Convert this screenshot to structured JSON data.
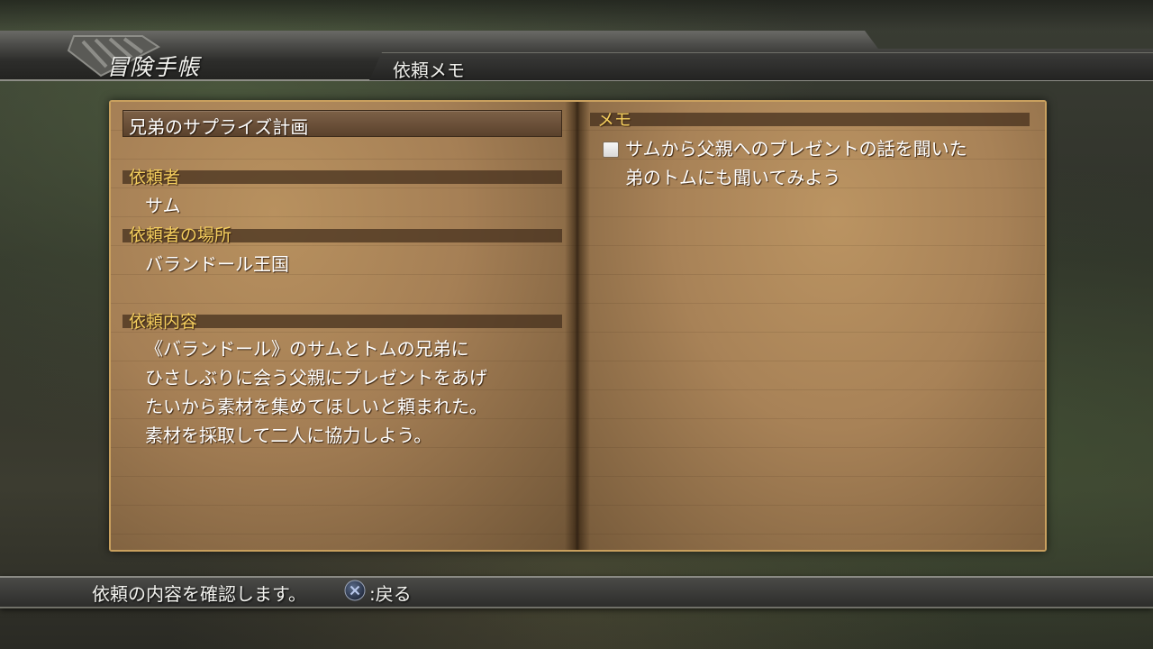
{
  "header": {
    "title": "冒険手帳",
    "subtitle": "依頼メモ"
  },
  "quest": {
    "title": "兄弟のサプライズ計画",
    "client_label": "依頼者",
    "client": "サム",
    "location_label": "依頼者の場所",
    "location": "バランドール王国",
    "details_label": "依頼内容",
    "details_lines": [
      "《バランドール》のサムとトムの兄弟に",
      "ひさしぶりに会う父親にプレゼントをあげ",
      "たいから素材を集めてほしいと頼まれた。",
      "素材を採取して二人に協力しよう。"
    ]
  },
  "memo": {
    "label": "メモ",
    "items": [
      {
        "checked": false,
        "lines": [
          "サムから父親へのプレゼントの話を聞いた",
          "弟のトムにも聞いてみよう"
        ]
      }
    ]
  },
  "footer": {
    "hint": "依頼の内容を確認します。",
    "back_button_icon": "cross-button-icon",
    "back_label": ":戻る"
  },
  "colors": {
    "accent_label": "#f4ce5e",
    "book_border": "#c9a05e",
    "page": "#a98356"
  }
}
